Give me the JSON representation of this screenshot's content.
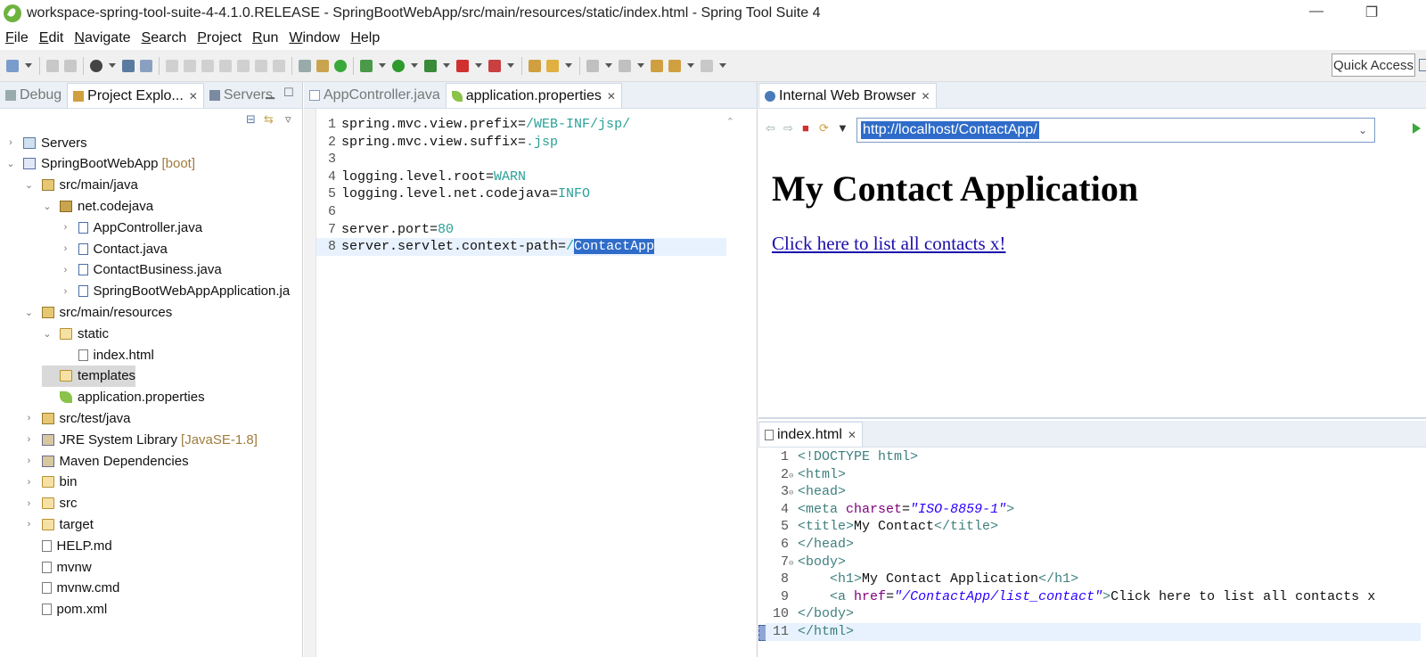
{
  "window": {
    "title": "workspace-spring-tool-suite-4-4.1.0.RELEASE - SpringBootWebApp/src/main/resources/static/index.html - Spring Tool Suite 4",
    "minimize": "—",
    "maximize": "❐"
  },
  "menu": [
    {
      "first": "F",
      "rest": "ile"
    },
    {
      "first": "E",
      "rest": "dit"
    },
    {
      "first": "N",
      "rest": "avigate"
    },
    {
      "first": "S",
      "rest": "earch"
    },
    {
      "first": "P",
      "rest": "roject"
    },
    {
      "first": "R",
      "rest": "un"
    },
    {
      "first": "W",
      "rest": "indow"
    },
    {
      "first": "H",
      "rest": "elp"
    }
  ],
  "toolbar": {
    "quick_access": "Quick Access"
  },
  "left_tabs": [
    {
      "label": "Debug",
      "active": false,
      "icon": "debug-icon"
    },
    {
      "label": "Project Explo...",
      "active": true,
      "icon": "project-explorer-icon",
      "close": "✕"
    },
    {
      "label": "Servers",
      "active": false,
      "icon": "servers-icon"
    }
  ],
  "tree": [
    {
      "label": "Servers",
      "icon": "servers-icon",
      "chev": "›"
    },
    {
      "label": "SpringBootWebApp",
      "suffix": "[boot]",
      "icon": "project-icon",
      "chev": "⌄"
    },
    {
      "label": "src/main/java",
      "icon": "source-folder-icon",
      "chev": "⌄"
    },
    {
      "label": "net.codejava",
      "icon": "package-icon",
      "chev": "⌄"
    },
    {
      "label": "AppController.java",
      "icon": "java-file-icon",
      "chev": "›"
    },
    {
      "label": "Contact.java",
      "icon": "java-file-icon",
      "chev": "›"
    },
    {
      "label": "ContactBusiness.java",
      "icon": "java-file-icon",
      "chev": "›"
    },
    {
      "label": "SpringBootWebAppApplication.ja",
      "icon": "java-file-icon",
      "chev": "›"
    },
    {
      "label": "src/main/resources",
      "icon": "source-folder-icon",
      "chev": "⌄"
    },
    {
      "label": "static",
      "icon": "folder-icon",
      "chev": "⌄"
    },
    {
      "label": "index.html",
      "icon": "file-icon",
      "chev": ""
    },
    {
      "label": "templates",
      "icon": "folder-icon",
      "chev": "",
      "selected": true
    },
    {
      "label": "application.properties",
      "icon": "spring-leaf-icon",
      "chev": ""
    },
    {
      "label": "src/test/java",
      "icon": "source-folder-icon",
      "chev": "›"
    },
    {
      "label": "JRE System Library",
      "suffix": "[JavaSE-1.8]",
      "icon": "library-icon",
      "chev": "›"
    },
    {
      "label": "Maven Dependencies",
      "icon": "library-icon",
      "chev": "›"
    },
    {
      "label": "bin",
      "icon": "folder-icon",
      "chev": "›"
    },
    {
      "label": "src",
      "icon": "folder-icon",
      "chev": "›"
    },
    {
      "label": "target",
      "icon": "folder-icon",
      "chev": "›"
    },
    {
      "label": "HELP.md",
      "icon": "file-icon",
      "chev": ""
    },
    {
      "label": "mvnw",
      "icon": "file-icon",
      "chev": ""
    },
    {
      "label": "mvnw.cmd",
      "icon": "file-icon",
      "chev": ""
    },
    {
      "label": "pom.xml",
      "icon": "file-icon",
      "chev": ""
    }
  ],
  "editor": {
    "tabs": [
      {
        "label": "AppController.java",
        "active": false
      },
      {
        "label": "application.properties",
        "active": true,
        "close": "✕"
      }
    ],
    "lines": [
      {
        "n": "1",
        "key": "spring.mvc.view.prefix=",
        "val": "/WEB-INF/jsp/"
      },
      {
        "n": "2",
        "key": "spring.mvc.view.suffix=",
        "val": ".jsp"
      },
      {
        "n": "3",
        "key": "",
        "val": ""
      },
      {
        "n": "4",
        "key": "logging.level.root=",
        "val": "WARN"
      },
      {
        "n": "5",
        "key": "logging.level.net.codejava=",
        "val": "INFO"
      },
      {
        "n": "6",
        "key": "",
        "val": ""
      },
      {
        "n": "7",
        "key": "server.port=",
        "val": "80"
      },
      {
        "n": "8",
        "key": "server.servlet.context-path=",
        "val": "/",
        "selected": "ContactApp"
      }
    ]
  },
  "browser": {
    "tab_label": "Internal Web Browser",
    "tab_close": "✕",
    "url": "http://localhost/ContactApp/",
    "heading": "My Contact Application",
    "link_text": "Click here to list all contacts x!"
  },
  "html_editor": {
    "tab_label": "index.html",
    "tab_close": "✕",
    "lines": [
      {
        "n": "1",
        "fold": "",
        "html": "<span class='tag'>&lt;!DOCTYPE html&gt;</span>"
      },
      {
        "n": "2",
        "fold": "⊖",
        "html": "<span class='tag'>&lt;html&gt;</span>"
      },
      {
        "n": "3",
        "fold": "⊖",
        "html": "<span class='tag'>&lt;head&gt;</span>"
      },
      {
        "n": "4",
        "fold": "",
        "html": "<span class='tag'>&lt;meta</span> <span class='attr'>charset</span>=<span class='str'>\"ISO-8859-1\"</span><span class='tag'>&gt;</span>"
      },
      {
        "n": "5",
        "fold": "",
        "html": "<span class='tag'>&lt;title&gt;</span>My Contact<span class='tag'>&lt;/title&gt;</span>"
      },
      {
        "n": "6",
        "fold": "",
        "html": "<span class='tag'>&lt;/head&gt;</span>"
      },
      {
        "n": "7",
        "fold": "⊖",
        "html": "<span class='tag'>&lt;body&gt;</span>"
      },
      {
        "n": "8",
        "fold": "",
        "html": "    <span class='tag'>&lt;h1&gt;</span>My Contact Application<span class='tag'>&lt;/h1&gt;</span>"
      },
      {
        "n": "9",
        "fold": "",
        "html": "    <span class='tag'>&lt;a</span> <span class='attr'>href</span>=<span class='str'>\"/ContactApp/list_contact\"</span><span class='tag'>&gt;</span>Click here to list all contacts x"
      },
      {
        "n": "10",
        "fold": "",
        "html": "<span class='tag'>&lt;/body&gt;</span>"
      },
      {
        "n": "11",
        "fold": "",
        "html": "<span class='tag'>&lt;/html&gt;</span>",
        "current": true
      }
    ]
  },
  "colors": {
    "selection": "#2f6cc9",
    "value_text": "#2aa198",
    "spring_green": "#6db33f",
    "link": "#1a0dab"
  }
}
